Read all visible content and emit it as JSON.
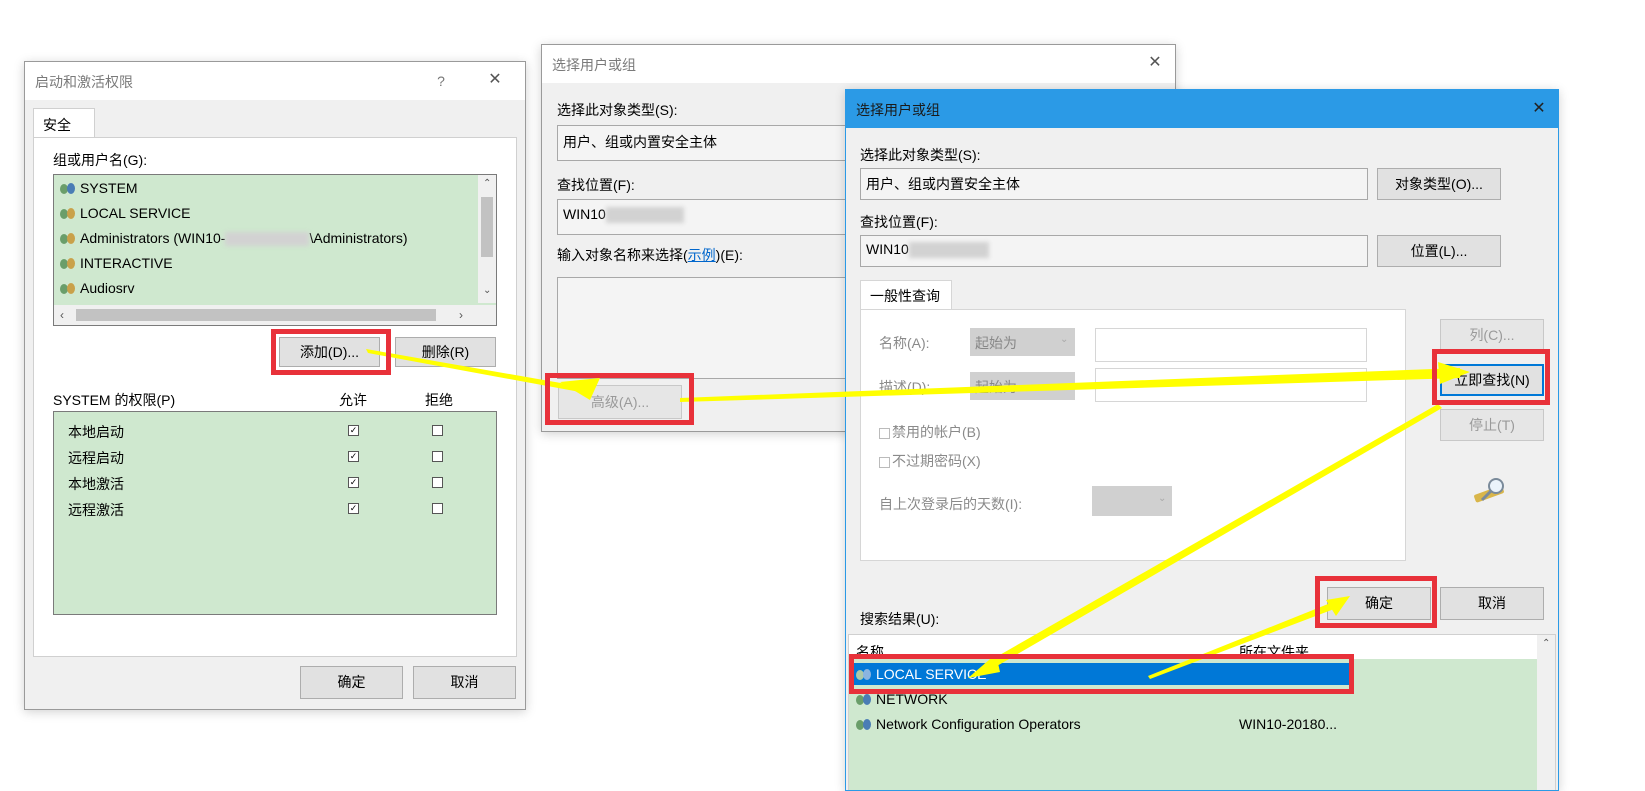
{
  "dialog1": {
    "title": "启动和激活权限",
    "help": "?",
    "close": "✕",
    "tab": "安全",
    "group_label": "组或用户名(G):",
    "users": [
      "SYSTEM",
      "LOCAL SERVICE",
      "Administrators (WIN10-",
      "INTERACTIVE",
      "Audiosrv"
    ],
    "admin_suffix": "\\Administrators)",
    "add_button": "添加(D)...",
    "remove_button": "删除(R)",
    "perm_label": "SYSTEM 的权限(P)",
    "allow": "允许",
    "deny": "拒绝",
    "perms": [
      {
        "name": "本地启动",
        "allow": true,
        "deny": false
      },
      {
        "name": "远程启动",
        "allow": true,
        "deny": false
      },
      {
        "name": "本地激活",
        "allow": true,
        "deny": false
      },
      {
        "name": "远程激活",
        "allow": true,
        "deny": false
      }
    ],
    "ok": "确定",
    "cancel": "取消"
  },
  "dialog2": {
    "title": "选择用户或组",
    "close": "✕",
    "obj_type_label": "选择此对象类型(S):",
    "obj_type_value": "用户、组或内置安全主体",
    "location_label": "查找位置(F):",
    "location_value": "WIN10",
    "enter_label_pre": "输入对象名称来选择(",
    "enter_label_link": "示例",
    "enter_label_post": ")(E):",
    "advanced_button": "高级(A)..."
  },
  "dialog3": {
    "title": "选择用户或组",
    "close": "✕",
    "obj_type_label": "选择此对象类型(S):",
    "obj_type_value": "用户、组或内置安全主体",
    "obj_type_button": "对象类型(O)...",
    "location_label": "查找位置(F):",
    "location_value": "WIN10",
    "location_button": "位置(L)...",
    "tab": "一般性查询",
    "name_label": "名称(A):",
    "desc_label": "描述(D):",
    "starts_with": "起始为",
    "disabled_accounts": "禁用的帐户(B)",
    "no_expire": "不过期密码(X)",
    "days_label": "自上次登录后的天数(I):",
    "columns_button": "列(C)...",
    "find_now_button": "立即查找(N)",
    "stop_button": "停止(T)",
    "ok": "确定",
    "cancel": "取消",
    "results_label": "搜索结果(U):",
    "col_name": "名称",
    "col_folder": "所在文件夹",
    "results": [
      {
        "name": "LOCAL SERVICE",
        "folder": ""
      },
      {
        "name": "NETWORK",
        "folder": ""
      },
      {
        "name": "Network Configuration Operators",
        "folder": "WIN10-20180..."
      }
    ]
  },
  "colors": {
    "highlight_red": "#e8313a",
    "arrow_yellow": "#ffff00",
    "selection_blue": "#0078d7",
    "list_green": "#cfe8cf",
    "active_title": "#2b9ae6"
  }
}
